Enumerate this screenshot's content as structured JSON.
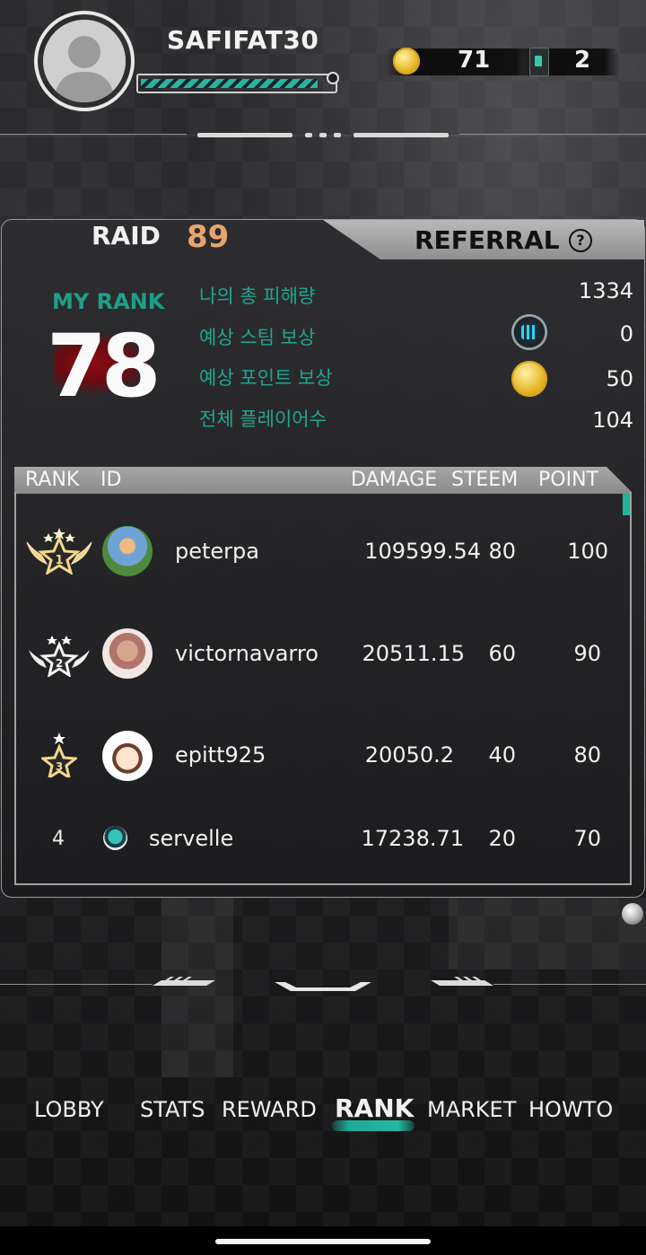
{
  "header": {
    "username": "SAFIFAT30",
    "xp_progress": 0.93,
    "coins": "71",
    "cards": "2"
  },
  "tabs": {
    "raid_label": "RAID",
    "raid_number": "89",
    "referral_label": "REFERRAL",
    "help": "?"
  },
  "my_rank": {
    "label": "MY RANK",
    "value": "78",
    "stats": [
      {
        "label": "나의 총 피해량",
        "value": "1334"
      },
      {
        "label": "예상 스팀 보상",
        "value": "0"
      },
      {
        "label": "예상 포인트 보상",
        "value": "50"
      },
      {
        "label": "전체 플레이어수",
        "value": "104"
      }
    ]
  },
  "table": {
    "headers": [
      "RANK",
      "ID",
      "DAMAGE",
      "STEEM",
      "POINT"
    ],
    "rows": [
      {
        "rank": "1",
        "name": "peterpa",
        "damage": "109599.54",
        "steem": "80",
        "point": "100"
      },
      {
        "rank": "2",
        "name": "victornavarro",
        "damage": "20511.15",
        "steem": "60",
        "point": "90"
      },
      {
        "rank": "3",
        "name": "epitt925",
        "damage": "20050.2",
        "steem": "40",
        "point": "80"
      },
      {
        "rank": "4",
        "name": "servelle",
        "damage": "17238.71",
        "steem": "20",
        "point": "70"
      }
    ]
  },
  "nav": {
    "items": [
      "LOBBY",
      "STATS",
      "REWARD",
      "RANK",
      "MARKET",
      "HOWTO"
    ],
    "active": "RANK"
  },
  "colors": {
    "accent_teal": "#1f9f88",
    "raid_orange": "#e7a56e",
    "blood_red": "#8a0d12"
  }
}
